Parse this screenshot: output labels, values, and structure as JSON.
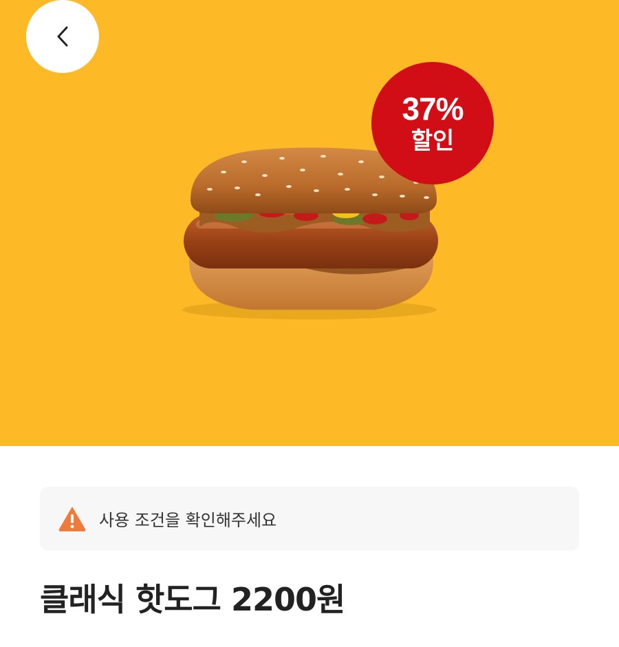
{
  "header": {
    "back_icon": "chevron-left-icon"
  },
  "promo": {
    "discount_percent": "37%",
    "discount_label": "할인",
    "badge_color": "#D10E16",
    "background_color": "#FDBA26"
  },
  "notice": {
    "icon": "warning-icon",
    "icon_color": "#EE7B3A",
    "text": "사용 조건을 확인해주세요"
  },
  "product": {
    "title": "클래식 핫도그 2200원"
  }
}
